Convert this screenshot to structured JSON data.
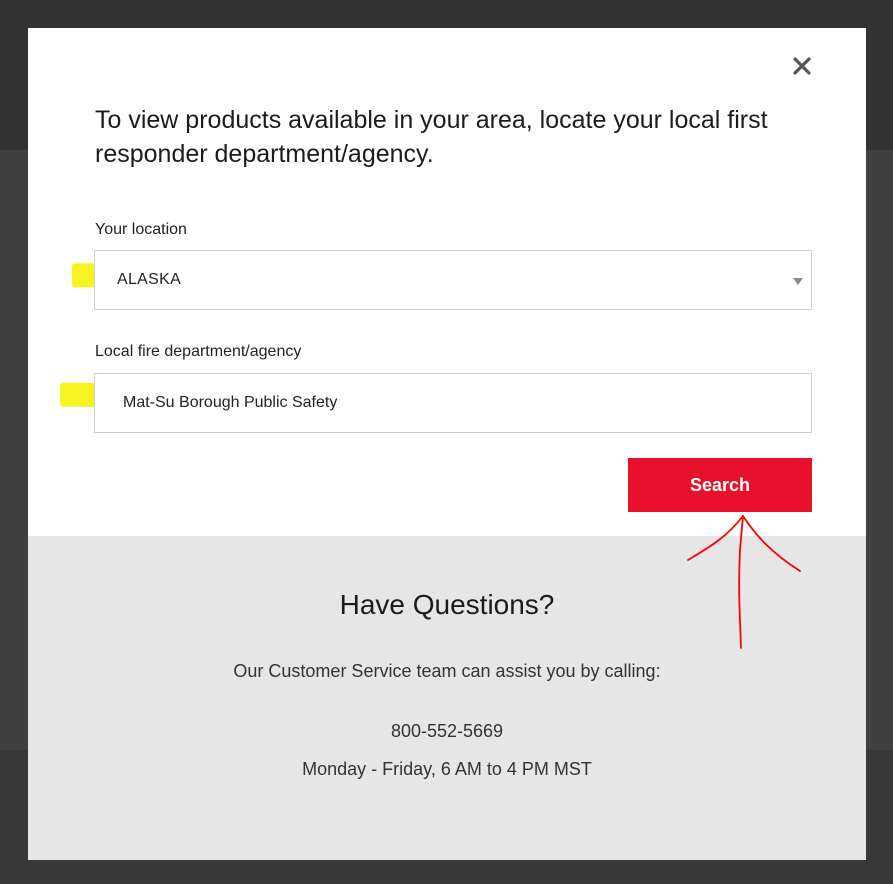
{
  "modal": {
    "heading": "To view products available in your area, locate your local first responder department/agency.",
    "close_icon": "close-icon",
    "location": {
      "label": "Your location",
      "selected_value": "ALASKA"
    },
    "department": {
      "label": "Local fire department/agency",
      "value": "Mat-Su Borough Public Safety"
    },
    "search_button": {
      "label": "Search",
      "color": "#e8102b"
    }
  },
  "questions": {
    "title": "Have Questions?",
    "text": "Our Customer Service team can assist you by calling:",
    "phone": "800-552-5669",
    "hours": "Monday - Friday, 6 AM to 4 PM MST"
  },
  "annotations": {
    "highlight_color": "#f6f20e",
    "arrow_color": "#ff0000"
  }
}
